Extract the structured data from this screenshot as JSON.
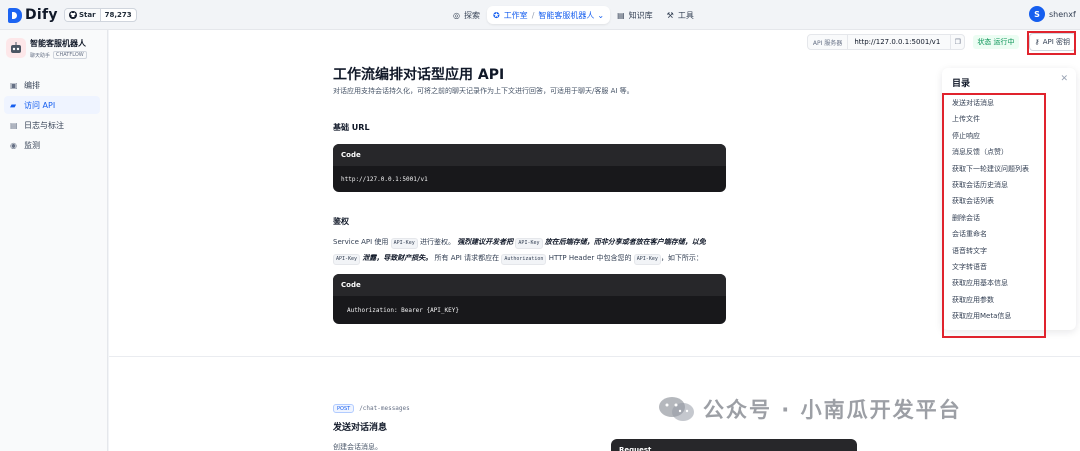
{
  "topbar": {
    "logo": "Dify",
    "star_label": "Star",
    "star_count": "78,273",
    "nav": [
      {
        "label": "探索",
        "icon": "compass-icon"
      },
      {
        "label": "工作室",
        "icon": "robot-icon"
      },
      {
        "label": "知识库",
        "icon": "book-icon"
      },
      {
        "label": "工具",
        "icon": "tool-icon"
      }
    ],
    "active_app": "智能客服机器人",
    "user_initial": "S",
    "username": "shenxf"
  },
  "sidebar": {
    "app_name": "智能客服机器人",
    "app_sub": "聊天助手",
    "app_type": "CHATFLOW",
    "items": [
      {
        "label": "编排",
        "icon": "layout-icon"
      },
      {
        "label": "访问 API",
        "icon": "terminal-icon"
      },
      {
        "label": "日志与标注",
        "icon": "log-icon"
      },
      {
        "label": "监测",
        "icon": "monitor-icon"
      }
    ]
  },
  "toolbar": {
    "api_label": "API 服务器",
    "api_url": "http://127.0.0.1:5001/v1",
    "status": "状态 运行中",
    "key_button": "API 密钥"
  },
  "doc": {
    "title": "工作流编排对话型应用 API",
    "lead": "对话应用支持会话持久化，可将之前的聊天记录作为上下文进行回答，可适用于聊天/客服 AI 等。",
    "base_url_heading": "基础 URL",
    "code_label": "Code",
    "base_url_code": "http://127.0.0.1:5001/v1",
    "auth_heading": "鉴权",
    "auth_p1": "Service API 使用",
    "auth_code1": "API-Key",
    "auth_p2": "进行鉴权。",
    "auth_b1": "强烈建议开发者把",
    "auth_code2": "API-Key",
    "auth_b2": "放在后端存储，而非分享或者放在客户端存储，以免",
    "auth_code3": "API-Key",
    "auth_b3": "泄露，导致财产损失。",
    "auth_p3": "所有 API 请求都应在",
    "auth_code4": "Authorization",
    "auth_p4": "HTTP Header 中包含您的",
    "auth_code5": "API-Key",
    "auth_p5": "，如下所示：",
    "auth_code": "Authorization: Bearer {API_KEY}",
    "post_tag": "POST",
    "post_path": "/chat-messages",
    "section_title": "发送对话消息",
    "section_desc": "创建会话消息。",
    "request_label": "Request"
  },
  "toc": {
    "title": "目录",
    "items": [
      "发送对话消息",
      "上传文件",
      "停止响应",
      "消息反馈（点赞）",
      "获取下一轮建议问题列表",
      "获取会话历史消息",
      "获取会话列表",
      "删除会话",
      "会话重命名",
      "语音转文字",
      "文字转语音",
      "获取应用基本信息",
      "获取应用参数",
      "获取应用Meta信息"
    ]
  },
  "watermark": "公众号 · 小南瓜开发平台",
  "colors": {
    "accent": "#155eef",
    "highlight": "#e0232d",
    "status_green": "#079455"
  }
}
